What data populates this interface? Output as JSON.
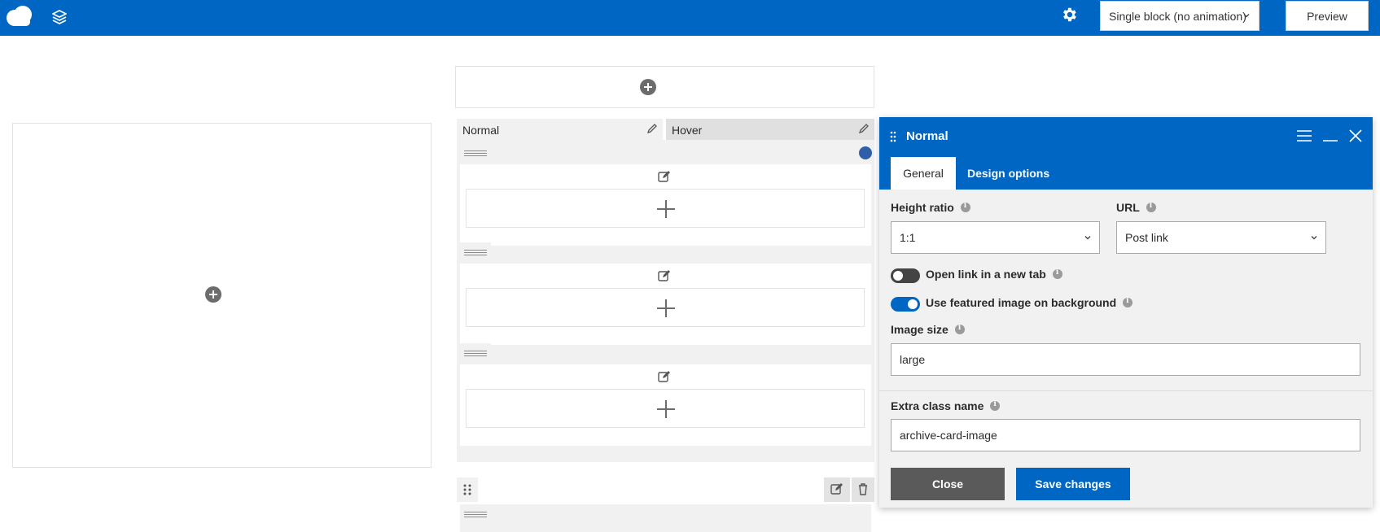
{
  "topbar": {
    "logo_icon": "cloud-logo-icon",
    "layers_icon": "layers-icon",
    "settings_icon": "gear-icon",
    "mode_select": "Single block (no animation)",
    "preview_label": "Preview"
  },
  "builder": {
    "tabs": [
      {
        "label": "Normal"
      },
      {
        "label": "Hover"
      }
    ]
  },
  "panel": {
    "title": "Normal",
    "tabs": [
      {
        "label": "General"
      },
      {
        "label": "Design options"
      }
    ],
    "height_ratio": {
      "label": "Height ratio",
      "value": "1:1"
    },
    "url": {
      "label": "URL",
      "value": "Post link"
    },
    "open_new_tab": {
      "label": "Open link in a new tab",
      "checked": false
    },
    "featured_bg": {
      "label": "Use featured image on background",
      "checked": true
    },
    "image_size": {
      "label": "Image size",
      "value": "large"
    },
    "extra_class": {
      "label": "Extra class name",
      "value": "archive-card-image"
    },
    "close_label": "Close",
    "save_label": "Save changes"
  },
  "colors": {
    "brand": "#0066c4",
    "close_button": "#5a5a5a",
    "status_dot": "#2f5fa8"
  }
}
